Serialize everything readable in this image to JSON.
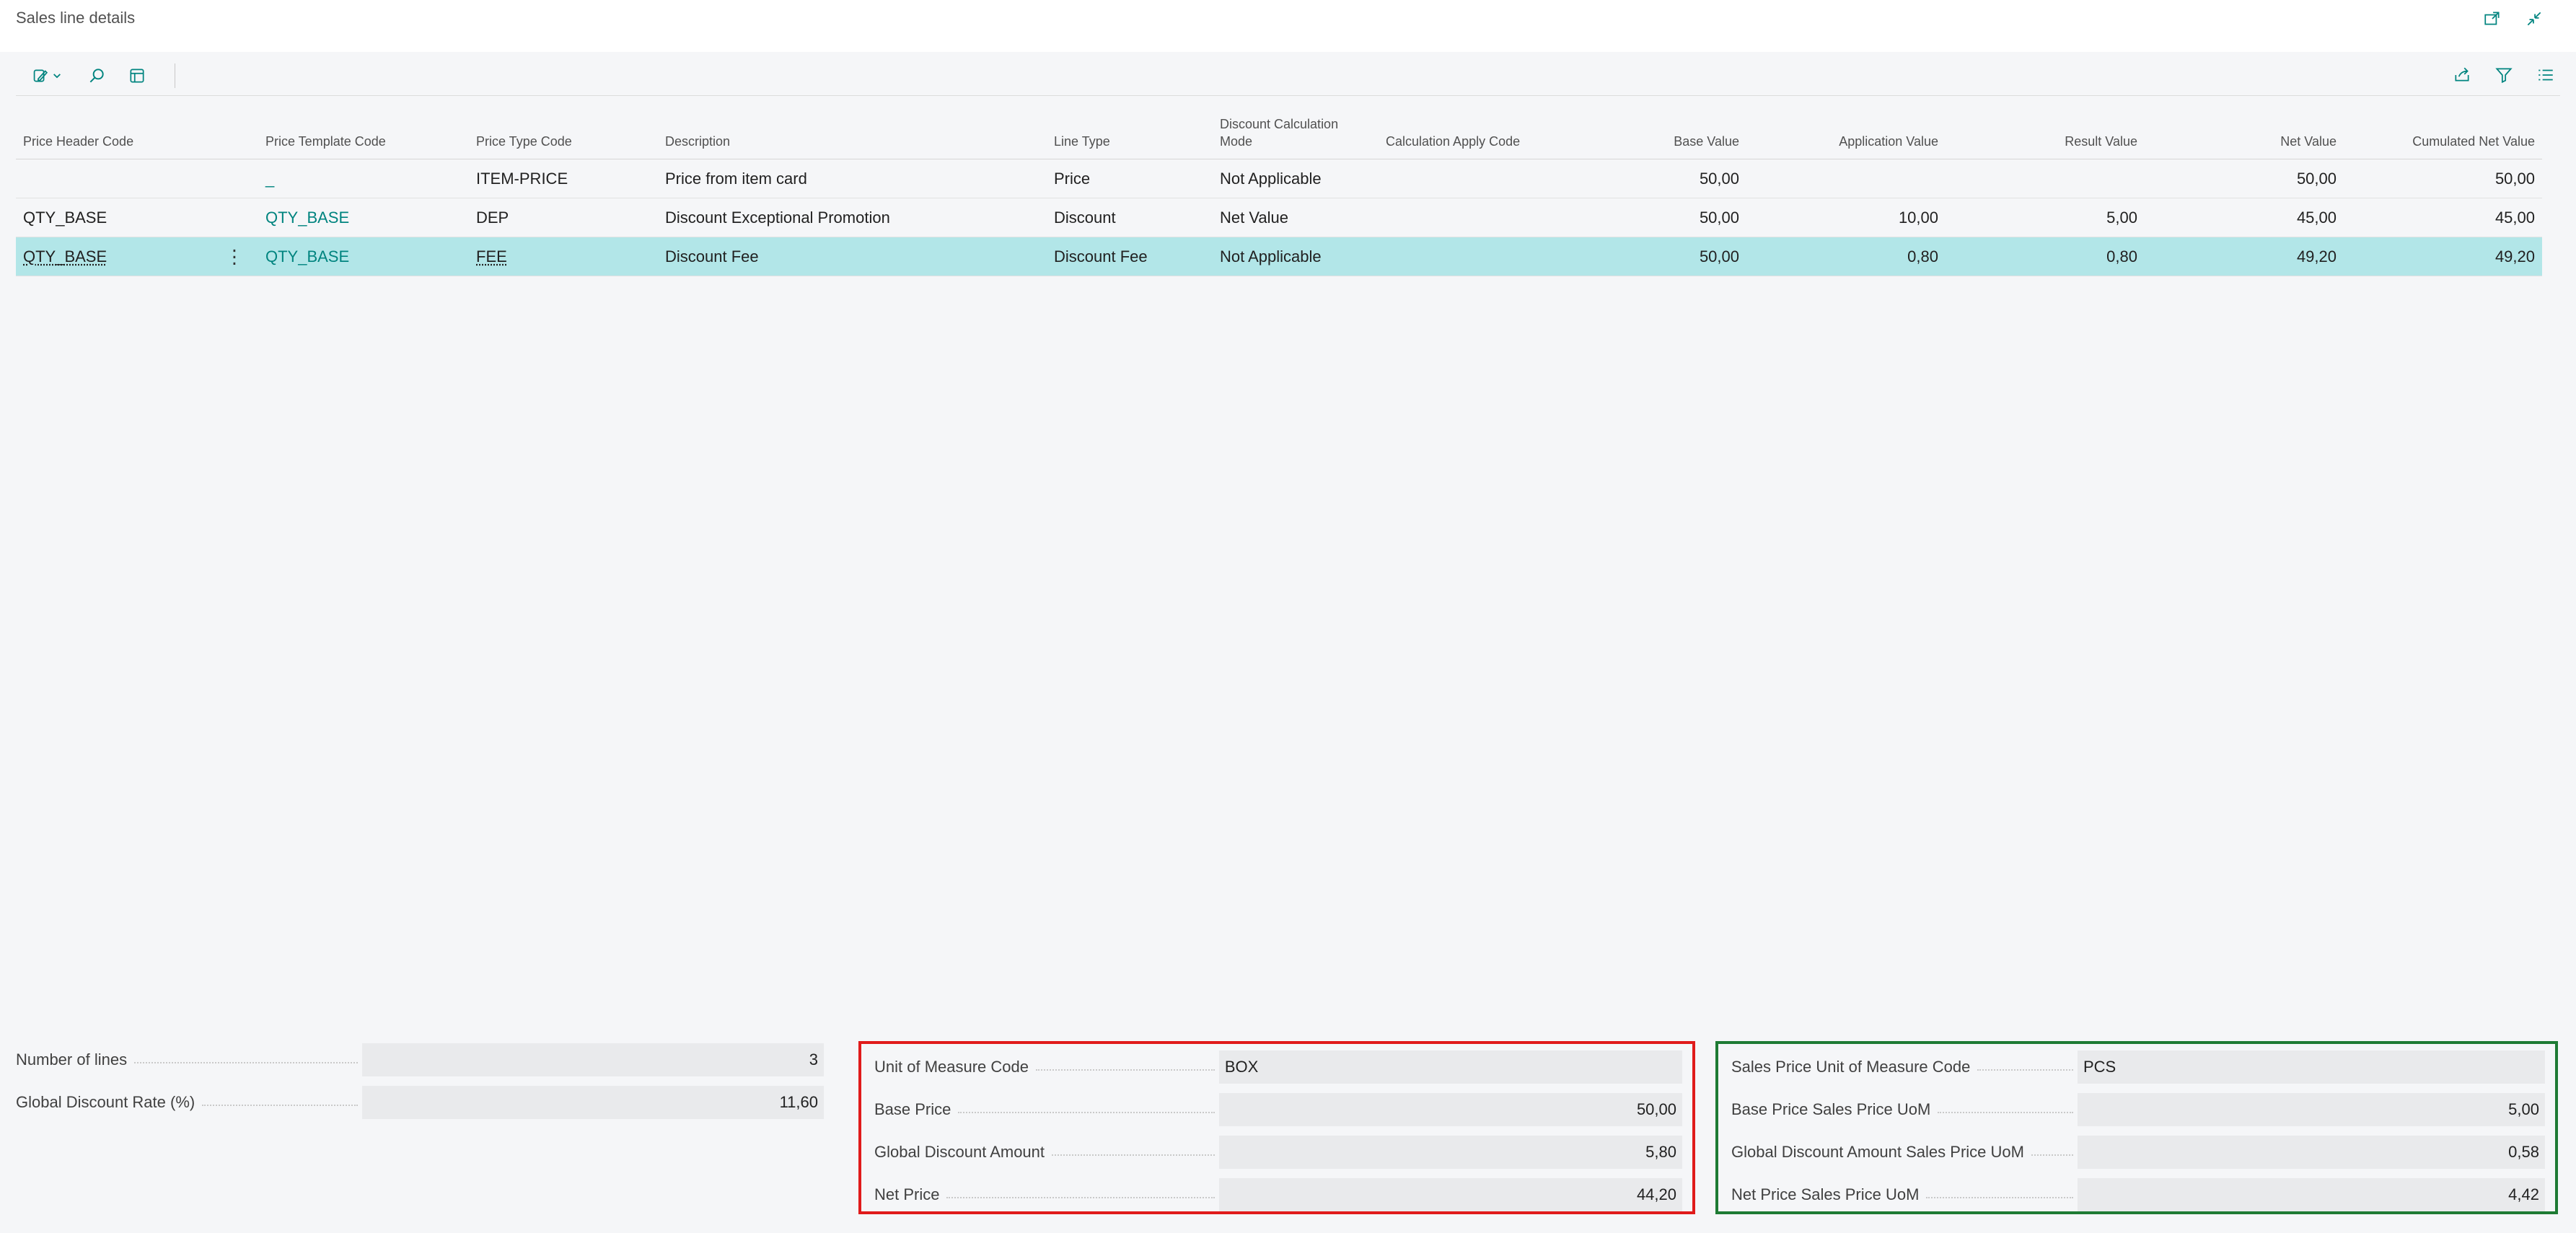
{
  "page": {
    "title": "Sales line details",
    "icons": [
      "open-in-new-window-icon",
      "collapse-icon"
    ]
  },
  "toolbar": {
    "left_icons": [
      "edit-mode-icon",
      "search-icon",
      "layout-icon"
    ],
    "right_icons": [
      "share-icon",
      "filter-icon",
      "list-view-icon"
    ]
  },
  "grid": {
    "columns": [
      "Price Header Code",
      "Price Template Code",
      "Price Type Code",
      "Description",
      "Line Type",
      "Discount Calculation Mode",
      "Calculation Apply Code",
      "Base Value",
      "Application Value",
      "Result Value",
      "Net Value",
      "Cumulated Net Value"
    ],
    "rows": [
      {
        "price_header_code": "",
        "price_template_code": "_",
        "price_type_code": "ITEM-PRICE",
        "description": "Price from item card",
        "line_type": "Price",
        "discount_calc_mode": "Not Applicable",
        "calc_apply_code": "",
        "base_value": "50,00",
        "application_value": "",
        "result_value": "",
        "net_value": "50,00",
        "cumulated_net_value": "50,00"
      },
      {
        "price_header_code": "QTY_BASE",
        "price_template_code": "QTY_BASE",
        "price_type_code": "DEP",
        "description": "Discount Exceptional Promotion",
        "line_type": "Discount",
        "discount_calc_mode": "Net Value",
        "calc_apply_code": "",
        "base_value": "50,00",
        "application_value": "10,00",
        "result_value": "5,00",
        "net_value": "45,00",
        "cumulated_net_value": "45,00"
      },
      {
        "price_header_code": "QTY_BASE",
        "price_template_code": "QTY_BASE",
        "price_type_code": "FEE",
        "description": "Discount Fee",
        "line_type": "Discount Fee",
        "discount_calc_mode": "Not Applicable",
        "calc_apply_code": "",
        "base_value": "50,00",
        "application_value": "0,80",
        "result_value": "0,80",
        "net_value": "49,20",
        "cumulated_net_value": "49,20",
        "row_menu": "⋮"
      }
    ]
  },
  "summary": {
    "number_of_lines_label": "Number of lines",
    "number_of_lines": "3",
    "global_discount_rate_label": "Global Discount Rate (%)",
    "global_discount_rate": "11,60"
  },
  "uom_group": {
    "border_color": "#e01b1b",
    "uom_code_label": "Unit of Measure Code",
    "uom_code": "BOX",
    "base_price_label": "Base Price",
    "base_price": "50,00",
    "global_discount_amount_label": "Global Discount Amount",
    "global_discount_amount": "5,80",
    "net_price_label": "Net Price",
    "net_price": "44,20"
  },
  "sales_uom_group": {
    "border_color": "#1e7b34",
    "uom_code_label": "Sales Price Unit of Measure Code",
    "uom_code": "PCS",
    "base_price_label": "Base Price Sales Price UoM",
    "base_price": "5,00",
    "global_discount_amount_label": "Global Discount Amount Sales Price UoM",
    "global_discount_amount": "0,58",
    "net_price_label": "Net Price Sales Price UoM",
    "net_price": "4,42"
  },
  "colors": {
    "accent": "#00847f",
    "selected_row": "#b2e6e8",
    "background": "#f5f6f8"
  }
}
